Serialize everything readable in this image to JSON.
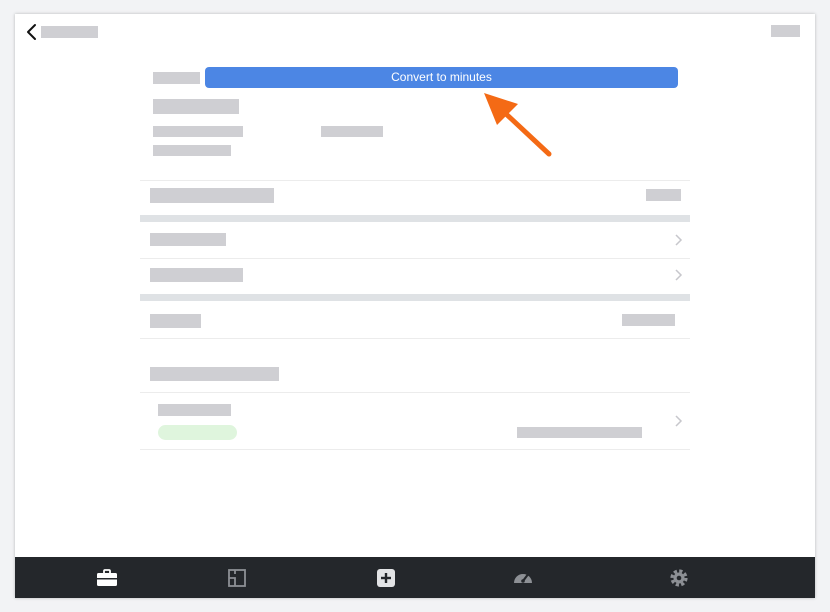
{
  "convert_button": {
    "label": "Convert to minutes"
  },
  "icons": {
    "back": "chevron-left-icon",
    "row_chevron": "chevron-right-icon",
    "tab_work": "briefcase-icon",
    "tab_layout": "floorplan-icon",
    "tab_add": "plus-square-icon",
    "tab_dashboard": "gauge-icon",
    "tab_settings": "gear-icon"
  },
  "colors": {
    "accent": "#4c86e4",
    "annotation_arrow": "#f46a15",
    "tabbar": "#24272b",
    "placeholder": "#cfcfd3",
    "status_pill": "#dff5dd"
  }
}
